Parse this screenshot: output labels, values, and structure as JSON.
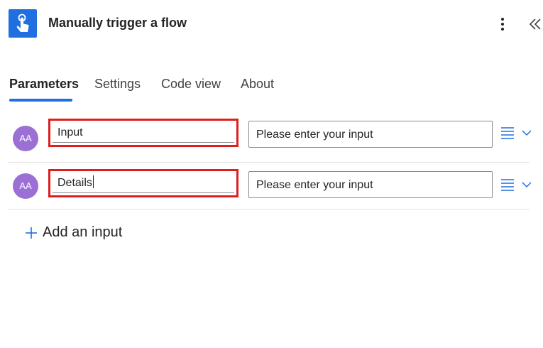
{
  "header": {
    "title": "Manually trigger a flow",
    "icon": "touch-hand-icon",
    "more_icon": "more-vertical-icon",
    "collapse_icon": "double-chevron-left-icon"
  },
  "tabs": [
    {
      "label": "Parameters",
      "active": true
    },
    {
      "label": "Settings",
      "active": false
    },
    {
      "label": "Code view",
      "active": false
    },
    {
      "label": "About",
      "active": false
    }
  ],
  "inputs": [
    {
      "avatar": "AA",
      "name": "Input",
      "placeholder": "Please enter your input",
      "highlighted": true
    },
    {
      "avatar": "AA",
      "name": "Details",
      "placeholder": "Please enter your input",
      "highlighted": true
    }
  ],
  "add_input_label": "Add an input",
  "colors": {
    "accent": "#1f6fe0",
    "highlight": "#e11d1d",
    "avatar": "#9b6fd4"
  }
}
